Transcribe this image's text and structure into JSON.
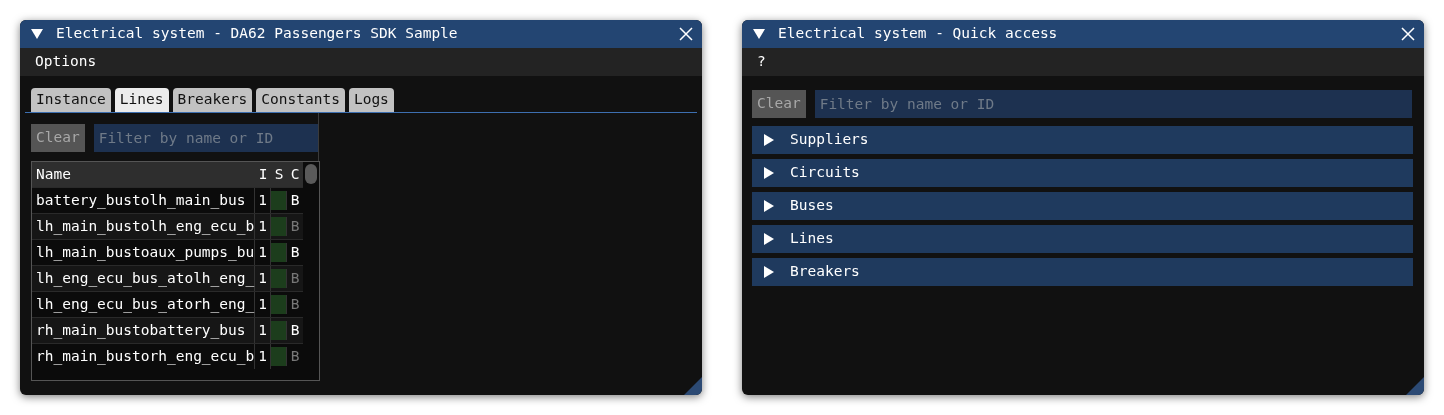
{
  "windows": [
    {
      "kind": "lines_browser",
      "title": "Electrical system - DA62 Passengers SDK Sample",
      "menu": [
        "Options"
      ],
      "tabs": [
        {
          "label": "Instance",
          "selected": false
        },
        {
          "label": "Lines",
          "selected": true
        },
        {
          "label": "Breakers",
          "selected": false
        },
        {
          "label": "Constants",
          "selected": false
        },
        {
          "label": "Logs",
          "selected": false
        }
      ],
      "filter": {
        "button": "Clear",
        "placeholder": "Filter by name or ID"
      },
      "table": {
        "columns": [
          "Name",
          "I",
          "S",
          "C"
        ],
        "rows": [
          {
            "name": "battery_bustolh_main_bus",
            "i": "1",
            "s_on": true,
            "c": "B",
            "c_active": true
          },
          {
            "name": "lh_main_bustolh_eng_ecu_b",
            "i": "1",
            "s_on": true,
            "c": "B",
            "c_active": false
          },
          {
            "name": "lh_main_bustoaux_pumps_bu",
            "i": "1",
            "s_on": true,
            "c": "B",
            "c_active": true
          },
          {
            "name": "lh_eng_ecu_bus_atolh_eng_",
            "i": "1",
            "s_on": true,
            "c": "B",
            "c_active": false
          },
          {
            "name": "lh_eng_ecu_bus_atorh_eng_",
            "i": "1",
            "s_on": true,
            "c": "B",
            "c_active": false
          },
          {
            "name": "rh_main_bustobattery_bus",
            "i": "1",
            "s_on": true,
            "c": "B",
            "c_active": true
          },
          {
            "name": "rh_main_bustorh_eng_ecu_b",
            "i": "1",
            "s_on": true,
            "c": "B",
            "c_active": false
          }
        ]
      }
    },
    {
      "kind": "quick_access",
      "title": "Electrical system - Quick access",
      "menu": [
        "?"
      ],
      "filter": {
        "button": "Clear",
        "placeholder": "Filter by name or ID"
      },
      "sections": [
        {
          "label": "Suppliers",
          "expanded": false
        },
        {
          "label": "Circuits",
          "expanded": false
        },
        {
          "label": "Buses",
          "expanded": false
        },
        {
          "label": "Lines",
          "expanded": false
        },
        {
          "label": "Breakers",
          "expanded": false
        }
      ]
    }
  ]
}
